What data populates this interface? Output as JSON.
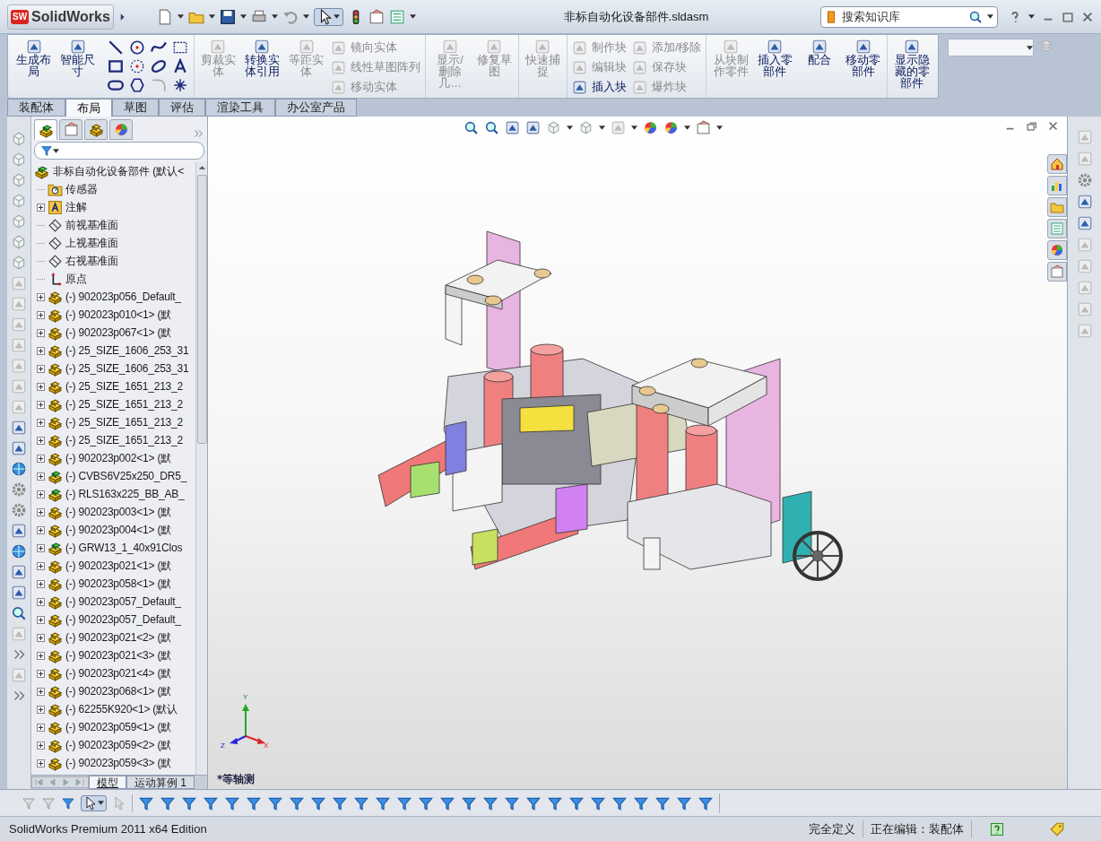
{
  "title_bar": {
    "logo_badge": "SW",
    "logo_text": "SolidWorks",
    "title": "非标自动化设备部件.sldasm",
    "search": {
      "placeholder": "搜索知识库"
    }
  },
  "ribbon": {
    "groups": [
      {
        "buttons": [
          {
            "label": "生成布局",
            "kind": "large",
            "disabled": false
          },
          {
            "label": "智能尺寸",
            "kind": "large",
            "disabled": false
          }
        ]
      },
      {
        "buttons": [
          {
            "label": "剪裁实体",
            "kind": "large",
            "disabled": true
          },
          {
            "label": "转换实体引用",
            "kind": "large",
            "disabled": false
          },
          {
            "label": "等距实体",
            "kind": "large",
            "disabled": true
          },
          {
            "label": "镜向实体",
            "kind": "small",
            "disabled": true
          },
          {
            "label": "线性草图阵列",
            "kind": "small",
            "disabled": true
          },
          {
            "label": "移动实体",
            "kind": "small",
            "disabled": true
          }
        ]
      },
      {
        "buttons": [
          {
            "label": "显示/删除几…",
            "kind": "large",
            "disabled": true
          },
          {
            "label": "修复草图",
            "kind": "large",
            "disabled": true
          }
        ]
      },
      {
        "buttons": [
          {
            "label": "快速捕捉",
            "kind": "large",
            "disabled": true
          }
        ]
      },
      {
        "buttons": [
          {
            "label": "制作块",
            "kind": "small",
            "disabled": true
          },
          {
            "label": "编辑块",
            "kind": "small",
            "disabled": true
          },
          {
            "label": "插入块",
            "kind": "small",
            "disabled": false
          },
          {
            "label": "添加/移除",
            "kind": "small",
            "disabled": true
          },
          {
            "label": "保存块",
            "kind": "small",
            "disabled": true
          },
          {
            "label": "爆炸块",
            "kind": "small",
            "disabled": true
          }
        ]
      },
      {
        "buttons": [
          {
            "label": "从块制作零件",
            "kind": "large",
            "disabled": true
          },
          {
            "label": "插入零部件",
            "kind": "large",
            "disabled": false
          },
          {
            "label": "配合",
            "kind": "large",
            "disabled": false
          },
          {
            "label": "移动零部件",
            "kind": "large",
            "disabled": false
          }
        ]
      },
      {
        "buttons": [
          {
            "label": "显示隐藏的零部件",
            "kind": "large",
            "disabled": false
          }
        ]
      }
    ]
  },
  "command_tabs": [
    {
      "label": "装配体",
      "selected": false
    },
    {
      "label": "布局",
      "selected": true
    },
    {
      "label": "草图",
      "selected": false
    },
    {
      "label": "评估",
      "selected": false
    },
    {
      "label": "渲染工具",
      "selected": false
    },
    {
      "label": "办公室产品",
      "selected": false
    }
  ],
  "feature_tree": {
    "root": {
      "label": "非标自动化设备部件  (默认<",
      "children": [
        {
          "label": "传感器",
          "kind": "sensors",
          "expandable": false
        },
        {
          "label": "注解",
          "kind": "annotations",
          "expandable": true
        },
        {
          "label": "前视基准面",
          "kind": "plane",
          "expandable": false
        },
        {
          "label": "上视基准面",
          "kind": "plane",
          "expandable": false
        },
        {
          "label": "右视基准面",
          "kind": "plane",
          "expandable": false
        },
        {
          "label": "原点",
          "kind": "origin",
          "expandable": false
        },
        {
          "label": "(-) 902023p056_Default_",
          "kind": "part",
          "expandable": true
        },
        {
          "label": "(-) 902023p010<1> (默",
          "kind": "part",
          "expandable": true
        },
        {
          "label": "(-) 902023p067<1> (默",
          "kind": "part",
          "expandable": true
        },
        {
          "label": "(-) 25_SIZE_1606_253_31",
          "kind": "part",
          "expandable": true
        },
        {
          "label": "(-) 25_SIZE_1606_253_31",
          "kind": "part",
          "expandable": true
        },
        {
          "label": "(-) 25_SIZE_1651_213_2",
          "kind": "part",
          "expandable": true
        },
        {
          "label": "(-) 25_SIZE_1651_213_2",
          "kind": "part",
          "expandable": true
        },
        {
          "label": "(-) 25_SIZE_1651_213_2",
          "kind": "part",
          "expandable": true
        },
        {
          "label": "(-) 25_SIZE_1651_213_2",
          "kind": "part",
          "expandable": true
        },
        {
          "label": "(-) 902023p002<1> (默",
          "kind": "part",
          "expandable": true
        },
        {
          "label": "(-) CVBS6V25x250_DR5_",
          "kind": "subassembly",
          "expandable": true
        },
        {
          "label": "(-) RLS163x225_BB_AB_",
          "kind": "subassembly",
          "expandable": true
        },
        {
          "label": "(-) 902023p003<1> (默",
          "kind": "part",
          "expandable": true
        },
        {
          "label": "(-) 902023p004<1> (默",
          "kind": "part",
          "expandable": true
        },
        {
          "label": "(-) GRW13_1_40x91Clos",
          "kind": "subassembly",
          "expandable": true
        },
        {
          "label": "(-) 902023p021<1> (默",
          "kind": "part",
          "expandable": true
        },
        {
          "label": "(-) 902023p058<1> (默",
          "kind": "part",
          "expandable": true
        },
        {
          "label": "(-) 902023p057_Default_",
          "kind": "part",
          "expandable": true
        },
        {
          "label": "(-) 902023p057_Default_",
          "kind": "part",
          "expandable": true
        },
        {
          "label": "(-) 902023p021<2> (默",
          "kind": "part",
          "expandable": true
        },
        {
          "label": "(-) 902023p021<3> (默",
          "kind": "part",
          "expandable": true
        },
        {
          "label": "(-) 902023p021<4> (默",
          "kind": "part",
          "expandable": true
        },
        {
          "label": "(-) 902023p068<1> (默",
          "kind": "part",
          "expandable": true
        },
        {
          "label": "(-) 62255K920<1> (默认",
          "kind": "part",
          "expandable": true
        },
        {
          "label": "(-) 902023p059<1> (默",
          "kind": "part",
          "expandable": true
        },
        {
          "label": "(-) 902023p059<2> (默",
          "kind": "part",
          "expandable": true
        },
        {
          "label": "(-) 902023p059<3> (默",
          "kind": "part",
          "expandable": true
        }
      ]
    }
  },
  "bottom_tabs": [
    {
      "label": "模型",
      "selected": true
    },
    {
      "label": "运动算例 1",
      "selected": false
    }
  ],
  "viewport": {
    "view_name": "*等轴测",
    "triad": {
      "x": "X",
      "y": "Y",
      "z": "Z"
    }
  },
  "status_bar": {
    "product": "SolidWorks Premium 2011 x64 Edition",
    "state": "完全定义",
    "editing": "正在编辑：装配体"
  }
}
